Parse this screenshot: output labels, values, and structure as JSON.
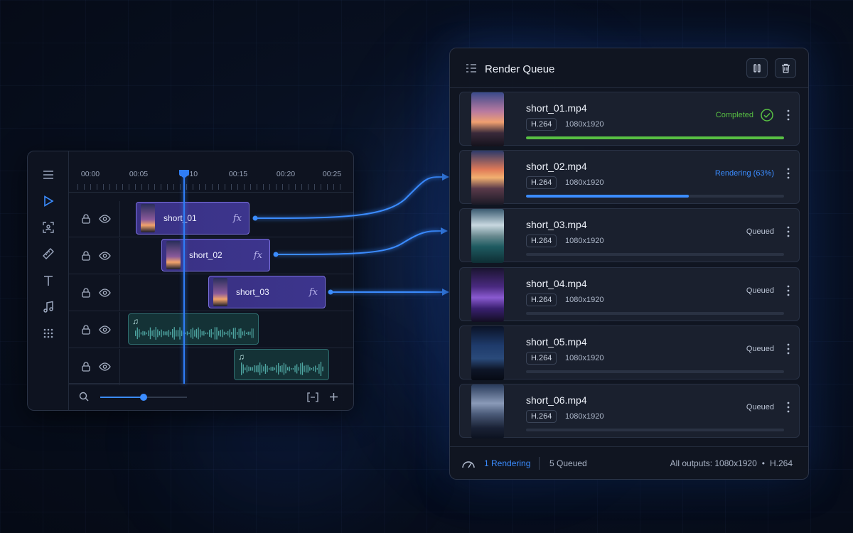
{
  "timeline": {
    "tools": [
      "menu-icon",
      "play-icon",
      "crop-icon",
      "ruler-icon",
      "text-icon",
      "music-icon",
      "grid-icon"
    ],
    "ruler_ticks": [
      "00:00",
      "00:05",
      "00:10",
      "00:15",
      "00:20",
      "00:25"
    ],
    "clips": [
      {
        "label": "short_01",
        "fx": "fx"
      },
      {
        "label": "short_02",
        "fx": "fx"
      },
      {
        "label": "short_03",
        "fx": "fx"
      }
    ],
    "zoom_level": 0.5
  },
  "queue": {
    "title": "Render Queue",
    "jobs": [
      {
        "name": "short_01.mp4",
        "codec": "H.264",
        "resolution": "1080x1920",
        "status": "Completed",
        "progress": 1.0
      },
      {
        "name": "short_02.mp4",
        "codec": "H.264",
        "resolution": "1080x1920",
        "status": "Rendering (63%)",
        "progress": 0.63
      },
      {
        "name": "short_03.mp4",
        "codec": "H.264",
        "resolution": "1080x1920",
        "status": "Queued",
        "progress": 0
      },
      {
        "name": "short_04.mp4",
        "codec": "H.264",
        "resolution": "1080x1920",
        "status": "Queued",
        "progress": 0
      },
      {
        "name": "short_05.mp4",
        "codec": "H.264",
        "resolution": "1080x1920",
        "status": "Queued",
        "progress": 0
      },
      {
        "name": "short_06.mp4",
        "codec": "H.264",
        "resolution": "1080x1920",
        "status": "Queued",
        "progress": 0
      }
    ],
    "footer": {
      "rendering": "1 Rendering",
      "queued": "5 Queued",
      "outputs": "All outputs: 1080x1920",
      "separator": "•",
      "codec": "H.264"
    }
  },
  "colors": {
    "accent": "#3b8cff",
    "completed": "#58c043",
    "clip": "#3c358d",
    "audio": "#143236"
  }
}
